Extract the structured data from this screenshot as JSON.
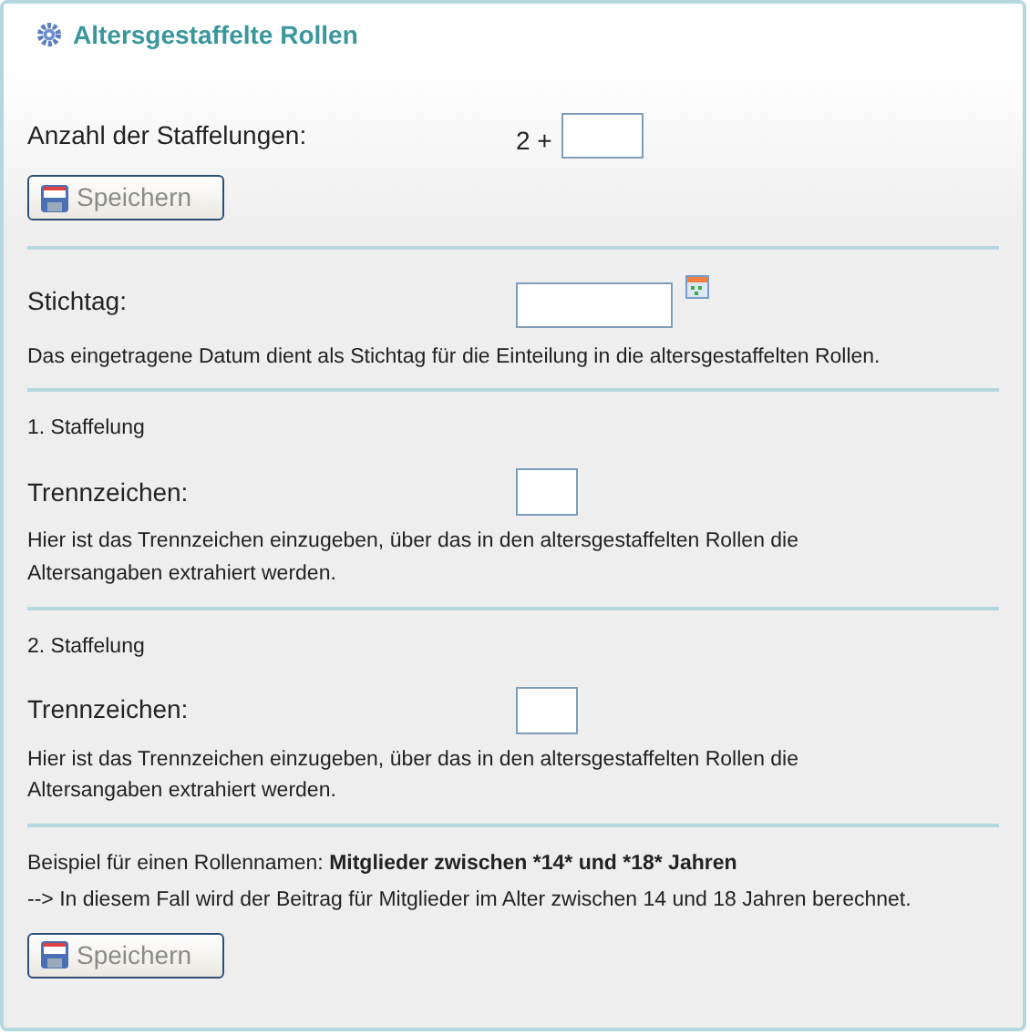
{
  "panel": {
    "title": "Altersgestaffelte Rollen"
  },
  "count": {
    "label": "Anzahl der Staffelungen:",
    "prefix": "2 +"
  },
  "save_buttons": [
    {
      "label": "Speichern",
      "disabled": true
    },
    {
      "label": "Speichern",
      "disabled": true
    }
  ],
  "key_date": {
    "label": "Stichtag:",
    "help": "Das eingetragene Datum dient als Stichtag für die Einteilung in die altersgestaffelten Rollen."
  },
  "tiers": [
    {
      "heading": "1. Staffelung",
      "label": "Trennzeichen:",
      "help": "Hier ist das Trennzeichen einzugeben, über das in den altersgestaffelten Rollen die Altersangaben extrahiert werden."
    },
    {
      "heading": "2. Staffelung",
      "label": "Trennzeichen:",
      "help": "Hier ist das Trennzeichen einzugeben, über das in den altersgestaffelten Rollen die Altersangaben extrahiert werden."
    }
  ],
  "example": {
    "intro": "Beispiel für einen Rollennamen:",
    "name": "Mitglieder zwischen *14* und *18* Jahren",
    "note": "--> In diesem Fall wird der Beitrag für Mitglieder im Alter zwischen 14 und 18 Jahren berechnet."
  }
}
